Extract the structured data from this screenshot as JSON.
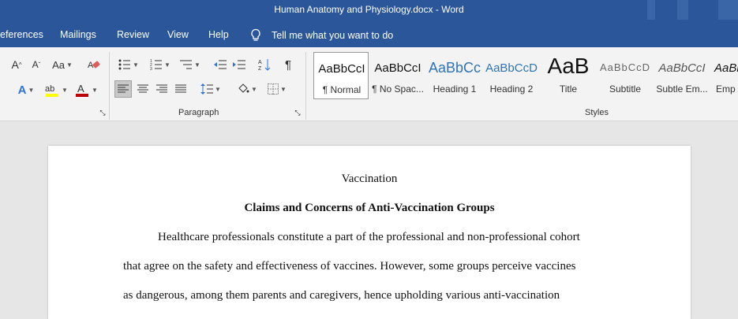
{
  "window": {
    "title": "Human Anatomy and Physiology.docx  -  Word"
  },
  "menu": {
    "items": [
      "eferences",
      "Mailings",
      "Review",
      "View",
      "Help"
    ],
    "tell_me": "Tell me what you want to do"
  },
  "ribbon": {
    "font_group": {
      "grow_font": "A",
      "shrink_font": "A",
      "change_case": "Aa",
      "highlight_color": "#ffff00",
      "font_color": "#c00000"
    },
    "paragraph": {
      "label": "Paragraph"
    },
    "styles": {
      "label": "Styles",
      "items": [
        {
          "preview": "AaBbCcI",
          "name": "¶ Normal",
          "selected": true
        },
        {
          "preview": "AaBbCcI",
          "name": "¶ No Spac..."
        },
        {
          "preview": "AaBbCc",
          "name": "Heading 1"
        },
        {
          "preview": "AaBbCcD",
          "name": "Heading 2"
        },
        {
          "preview": "AaB",
          "name": "Title"
        },
        {
          "preview": "AaBbCcD",
          "name": "Subtitle"
        },
        {
          "preview": "AaBbCcI",
          "name": "Subtle Em..."
        },
        {
          "preview": "AaBl",
          "name": "Emp"
        }
      ]
    }
  },
  "document": {
    "header": "Vaccination",
    "heading": "Claims and Concerns of Anti-Vaccination Groups",
    "lines": [
      "Healthcare professionals constitute a part of the professional and non-professional cohort",
      "that agree on the safety and effectiveness of vaccines. However, some groups perceive vaccines",
      "as dangerous, among them parents and caregivers, hence upholding various anti-vaccination"
    ]
  },
  "colors": {
    "brand": "#2b579a",
    "ribbon": "#f3f3f3",
    "canvas": "#e6e6e6"
  }
}
